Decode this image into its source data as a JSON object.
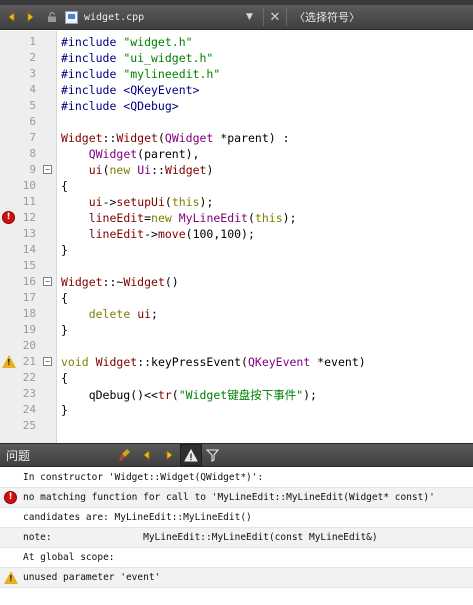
{
  "toolbar": {
    "back_icon": "arrow-left-icon",
    "forward_icon": "arrow-right-icon",
    "lock_icon": "lock-icon",
    "file_name": "widget.cpp",
    "close_label": "✕",
    "symbol_placeholder": "〈选择符号〉"
  },
  "editor": {
    "lines": [
      {
        "n": "1",
        "code": "#include \"widget.h\""
      },
      {
        "n": "2",
        "code": "#include \"ui_widget.h\""
      },
      {
        "n": "3",
        "code": "#include \"mylineedit.h\""
      },
      {
        "n": "4",
        "code": "#include <QKeyEvent>"
      },
      {
        "n": "5",
        "code": "#include <QDebug>"
      },
      {
        "n": "6",
        "code": ""
      },
      {
        "n": "7",
        "code": "Widget::Widget(QWidget *parent) :"
      },
      {
        "n": "8",
        "code": "    QWidget(parent),"
      },
      {
        "n": "9",
        "code": "    ui(new Ui::Widget)"
      },
      {
        "n": "10",
        "code": "{"
      },
      {
        "n": "11",
        "code": "    ui->setupUi(this);"
      },
      {
        "n": "12",
        "code": "    lineEdit=new MyLineEdit(this);"
      },
      {
        "n": "13",
        "code": "    lineEdit->move(100,100);"
      },
      {
        "n": "14",
        "code": "}"
      },
      {
        "n": "15",
        "code": ""
      },
      {
        "n": "16",
        "code": "Widget::~Widget()"
      },
      {
        "n": "17",
        "code": "{"
      },
      {
        "n": "18",
        "code": "    delete ui;"
      },
      {
        "n": "19",
        "code": "}"
      },
      {
        "n": "20",
        "code": ""
      },
      {
        "n": "21",
        "code": "void Widget::keyPressEvent(QKeyEvent *event)"
      },
      {
        "n": "22",
        "code": "{"
      },
      {
        "n": "23",
        "code": "    qDebug()<<tr(\"Widget键盘按下事件\");"
      },
      {
        "n": "24",
        "code": "}"
      },
      {
        "n": "25",
        "code": ""
      }
    ],
    "markers": {
      "line12": "error-icon",
      "line21": "warning-icon"
    },
    "fold_label": "−"
  },
  "issues_panel": {
    "title": "问题",
    "filter_icon": "filter-icon",
    "items": [
      {
        "text": "In constructor 'Widget::Widget(QWidget*)':",
        "icon": ""
      },
      {
        "text": "no matching function for call to 'MyLineEdit::MyLineEdit(Widget* const)'",
        "icon": "error-icon"
      },
      {
        "text": "candidates are: MyLineEdit::MyLineEdit()",
        "icon": ""
      },
      {
        "text": "note:                MyLineEdit::MyLineEdit(const MyLineEdit&)",
        "icon": ""
      },
      {
        "text": "At global scope:",
        "icon": ""
      },
      {
        "text": "unused parameter 'event'",
        "icon": "warning-icon"
      }
    ]
  },
  "colors": {
    "keyword": "#808000",
    "type": "#800080",
    "string": "#008000",
    "include": "#000080",
    "error": "#d01010",
    "warning": "#e8b020"
  }
}
